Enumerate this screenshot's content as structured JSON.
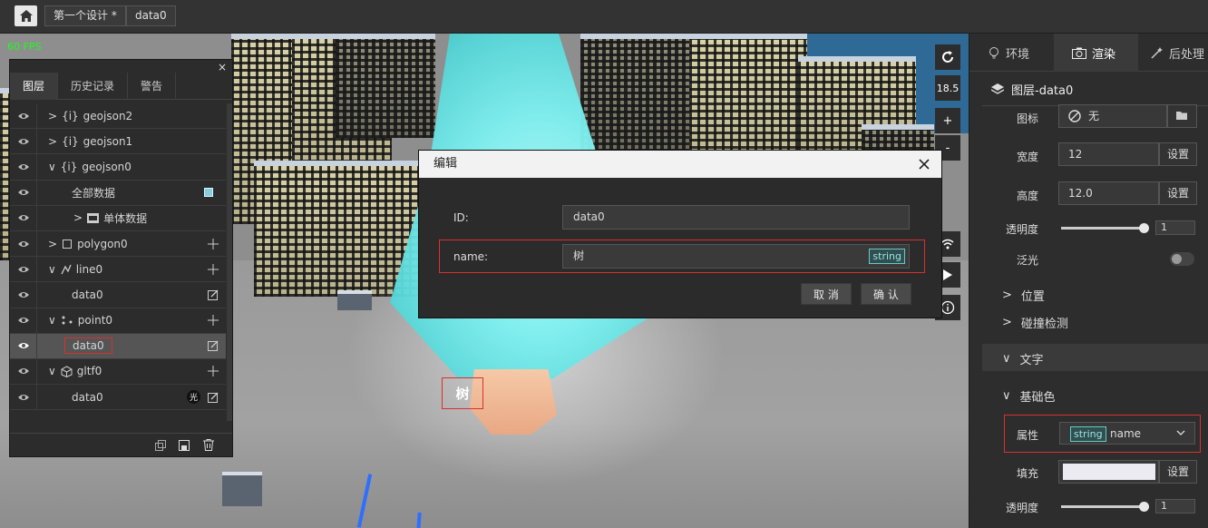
{
  "topbar": {
    "breadcrumbs": [
      "第一个设计 *",
      "data0"
    ]
  },
  "viewport": {
    "fps": "60 FPS",
    "tree_label": "树",
    "zoom_value": "18.5",
    "controls": {
      "zoom_in": "+",
      "zoom_out": "-"
    }
  },
  "layer_panel": {
    "close": "×",
    "tabs": [
      "图层",
      "历史记录",
      "警告"
    ],
    "rows": [
      {
        "label": "geojson2",
        "prefix": "{i}"
      },
      {
        "label": "geojson1",
        "prefix": "{i}"
      },
      {
        "label": "geojson0",
        "prefix": "{i}"
      },
      {
        "label": "全部数据"
      },
      {
        "label": "单体数据"
      },
      {
        "label": "polygon0"
      },
      {
        "label": "line0"
      },
      {
        "label": "data0"
      },
      {
        "label": "point0"
      },
      {
        "label": "data0"
      },
      {
        "label": "gltf0"
      },
      {
        "label": "data0",
        "badge": "光"
      }
    ]
  },
  "dialog": {
    "title": "编辑",
    "id_label": "ID:",
    "id_value": "data0",
    "name_label": "name:",
    "name_value": "树",
    "type_tag": "string",
    "cancel": "取 消",
    "confirm": "确 认"
  },
  "right_panel": {
    "tabs": [
      "环境",
      "渲染",
      "后处理"
    ],
    "title": "图层-data0",
    "icon_label": "图标",
    "icon_value": "无",
    "width_label": "宽度",
    "width_value": "12",
    "height_label": "高度",
    "height_value": "12.0",
    "set_label": "设置",
    "opacity_label": "透明度",
    "opacity_value": "1",
    "opacity_fraction": 0.95,
    "glow_label": "泛光",
    "position_label": "位置",
    "collision_label": "碰撞检测",
    "text_label": "文字",
    "base_color_label": "基础色",
    "attr_label": "属性",
    "attr_type": "string",
    "attr_value": "name",
    "fill_label": "填充",
    "fill_color": "#ecebf2",
    "opacity2_value": "1"
  },
  "colors": {
    "accent_red": "#d93030",
    "tree_cyan": "#7ff1f1",
    "fps_green": "#19ff19"
  }
}
